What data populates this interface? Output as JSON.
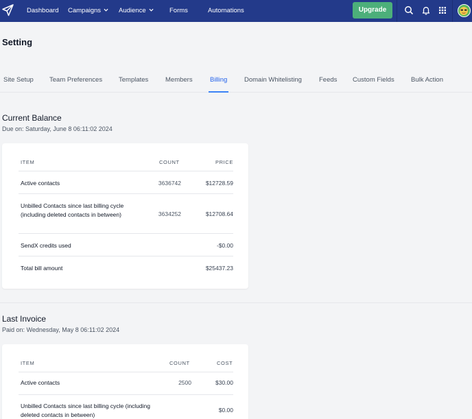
{
  "nav": {
    "items": [
      {
        "label": "Dashboard"
      },
      {
        "label": "Campaigns"
      },
      {
        "label": "Audience"
      },
      {
        "label": "Forms"
      },
      {
        "label": "Automations"
      }
    ],
    "upgrade_label": "Upgrade",
    "icons": [
      "search-icon",
      "bell-icon",
      "grid-icon"
    ]
  },
  "page": {
    "title": "Setting"
  },
  "tabs": [
    {
      "label": "Site Setup"
    },
    {
      "label": "Team Preferences"
    },
    {
      "label": "Templates"
    },
    {
      "label": "Members"
    },
    {
      "label": "Billing",
      "active": true
    },
    {
      "label": "Domain Whitelisting"
    },
    {
      "label": "Feeds"
    },
    {
      "label": "Custom Fields"
    },
    {
      "label": "Bulk Action"
    }
  ],
  "current_balance": {
    "title": "Current Balance",
    "due": "Due on: Saturday, June 8 06:11:02 2024",
    "headers": {
      "item": "ITEM",
      "count": "COUNT",
      "price": "PRICE"
    },
    "rows": [
      {
        "item": "Active contacts",
        "count": "3636742",
        "price": "$12728.59"
      },
      {
        "item": "Unbilled Contacts since last billing cycle (including deleted contacts in between)",
        "count": "3634252",
        "price": "$12708.64"
      },
      {
        "item": "SendX credits used",
        "count": "",
        "price": "-$0.00"
      },
      {
        "item": "Total bill amount",
        "count": "",
        "price": "$25437.23"
      }
    ]
  },
  "last_invoice": {
    "title": "Last Invoice",
    "paid": "Paid on: Wednesday, May 8 06:11:02 2024",
    "headers": {
      "item": "ITEM",
      "count": "COUNT",
      "cost": "COST"
    },
    "rows": [
      {
        "item": "Active contacts",
        "count": "2500",
        "cost": "$30.00"
      },
      {
        "item": "Unbilled Contacts since last billing cycle (including deleted contacts in between)",
        "count": "",
        "cost": "$0.00"
      }
    ]
  },
  "colors": {
    "navbar": "#233a8a",
    "accent": "#3b82f6",
    "upgrade": "#4caf7a"
  }
}
